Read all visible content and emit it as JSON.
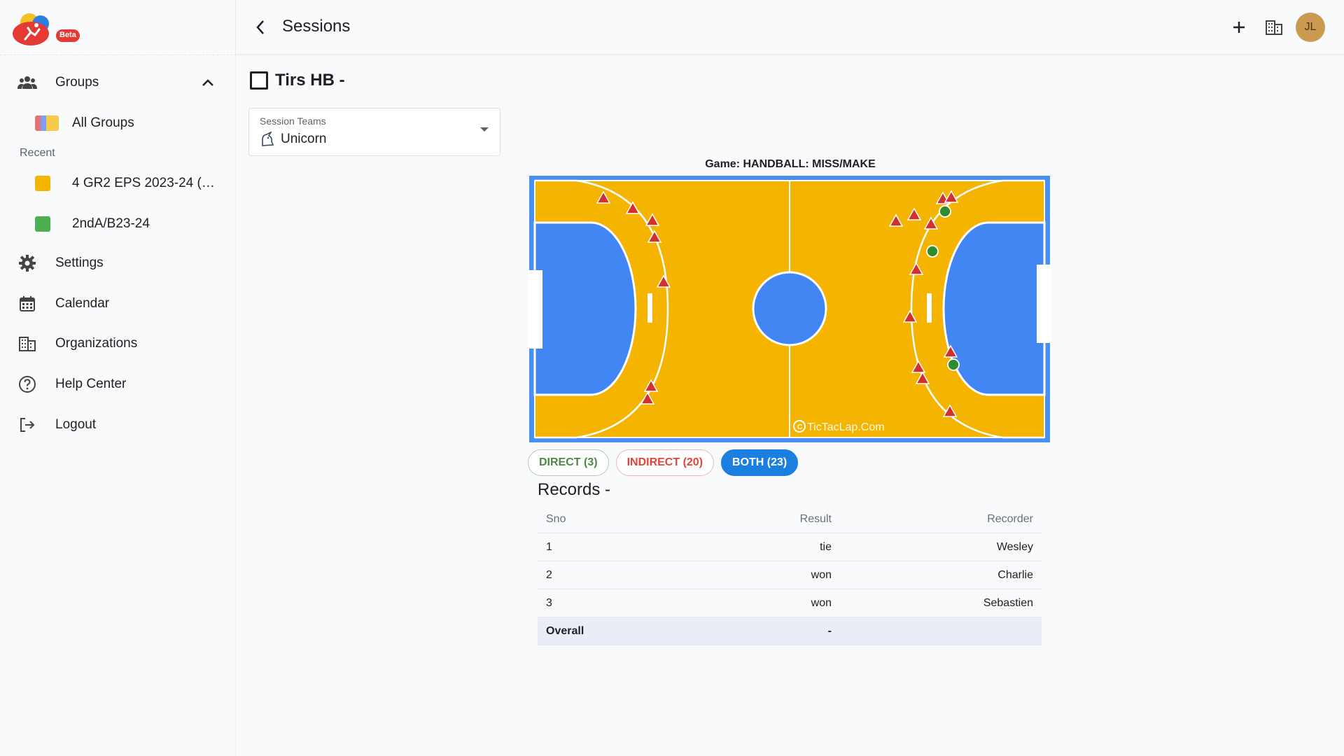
{
  "sidebar": {
    "logo_badge": "Beta",
    "groups_label": "Groups",
    "all_groups_label": "All Groups",
    "recent_label": "Recent",
    "recent_items": [
      {
        "label": "4 GR2 EPS 2023-24 (1…",
        "color": "#f4b400"
      },
      {
        "label": "2ndA/B23-24",
        "color": "#4caf50"
      }
    ],
    "settings_label": "Settings",
    "calendar_label": "Calendar",
    "organizations_label": "Organizations",
    "help_label": "Help Center",
    "logout_label": "Logout"
  },
  "header": {
    "title": "Sessions",
    "avatar_initials": "JL"
  },
  "session": {
    "title": "Tirs HB -",
    "teams_label": "Session Teams",
    "teams_value": "Unicorn",
    "game_label": "Game: HANDBALL: MISS/MAKE",
    "watermark": "TicTacLap.Com"
  },
  "filters": {
    "direct": "DIRECT (3)",
    "indirect": "INDIRECT (20)",
    "both": "BOTH (23)"
  },
  "records": {
    "title": "Records -",
    "headers": {
      "sno": "Sno",
      "result": "Result",
      "recorder": "Recorder"
    },
    "rows": [
      {
        "sno": "1",
        "result": "tie",
        "recorder": "Wesley"
      },
      {
        "sno": "2",
        "result": "won",
        "recorder": "Charlie"
      },
      {
        "sno": "3",
        "result": "won",
        "recorder": "Sebastien"
      }
    ],
    "overall": {
      "label": "Overall",
      "result": "-"
    }
  },
  "colors": {
    "court_yellow": "#f4b400",
    "court_blue": "#4286f4",
    "court_border": "#4a90f0",
    "miss_marker": "#d32f2f",
    "make_marker": "#2e8b2e",
    "primary": "#1a7fe0"
  }
}
